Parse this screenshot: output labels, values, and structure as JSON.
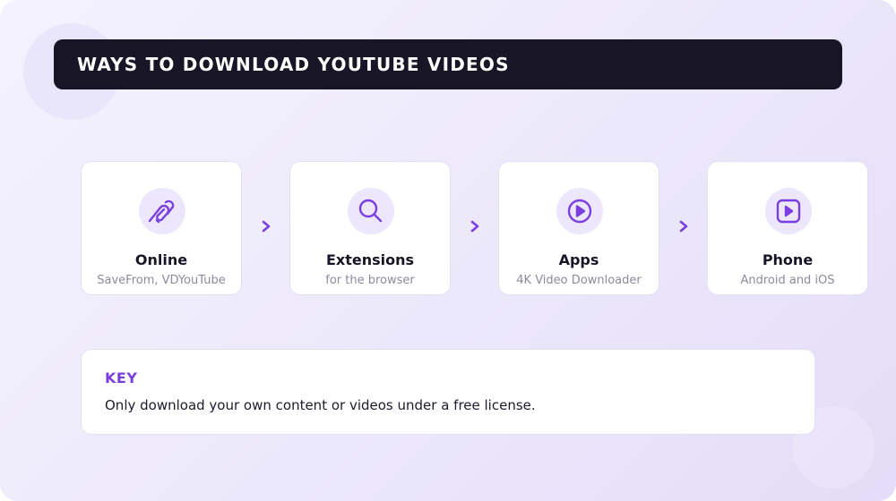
{
  "title": "WAYS TO DOWNLOAD YOUTUBE VIDEOS",
  "colors": {
    "accent": "#7b3fe0",
    "header_bg": "#181527",
    "icon_bg": "#ece7fc",
    "background": "#ece8fb"
  },
  "steps": [
    {
      "title": "Online",
      "subtitle": "SaveFrom, VDYouTube",
      "icon": "link-icon"
    },
    {
      "title": "Extensions",
      "subtitle": "for the browser",
      "icon": "search-icon"
    },
    {
      "title": "Apps",
      "subtitle": "4K Video Downloader",
      "icon": "play-circle-icon"
    },
    {
      "title": "Phone",
      "subtitle": "Android and iOS",
      "icon": "play-square-icon"
    }
  ],
  "connector_icon": "chevron-right-icon",
  "key": {
    "title": "KEY",
    "text": "Only download your own content or videos under a free license."
  }
}
